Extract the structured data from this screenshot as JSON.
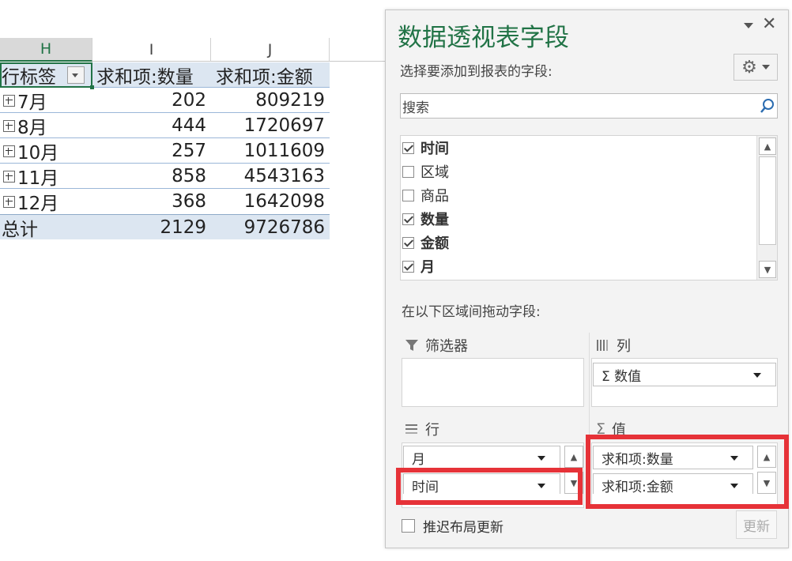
{
  "sheet": {
    "columns": [
      "H",
      "I",
      "J"
    ],
    "headers": {
      "row_label": "行标签",
      "sum_qty": "求和项:数量",
      "sum_amount": "求和项:金额"
    },
    "rows": [
      {
        "label": "7月",
        "qty": "202",
        "amount": "809219"
      },
      {
        "label": "8月",
        "qty": "444",
        "amount": "1720697"
      },
      {
        "label": "10月",
        "qty": "257",
        "amount": "1011609"
      },
      {
        "label": "11月",
        "qty": "858",
        "amount": "4543163"
      },
      {
        "label": "12月",
        "qty": "368",
        "amount": "1642098"
      }
    ],
    "total": {
      "label": "总计",
      "qty": "2129",
      "amount": "9726786"
    }
  },
  "pane": {
    "title": "数据透视表字段",
    "choose_label": "选择要添加到报表的字段:",
    "search_placeholder": "搜索",
    "fields": [
      {
        "name": "时间",
        "checked": true
      },
      {
        "name": "区域",
        "checked": false
      },
      {
        "name": "商品",
        "checked": false
      },
      {
        "name": "数量",
        "checked": true
      },
      {
        "name": "金额",
        "checked": true
      },
      {
        "name": "月",
        "checked": true
      }
    ],
    "drag_label": "在以下区域间拖动字段:",
    "areas": {
      "filters": {
        "label": "筛选器",
        "items": []
      },
      "columns": {
        "label": "列",
        "items": [
          "Σ 数值"
        ]
      },
      "rows": {
        "label": "行",
        "items": [
          "月",
          "时间"
        ]
      },
      "values": {
        "label": "值",
        "items": [
          "求和项:数量",
          "求和项:金额"
        ]
      }
    },
    "defer_label": "推迟布局更新",
    "update_label": "更新"
  },
  "colors": {
    "accent": "#217346",
    "highlight": "#e63238",
    "pivot_fill": "#dce6f1"
  }
}
